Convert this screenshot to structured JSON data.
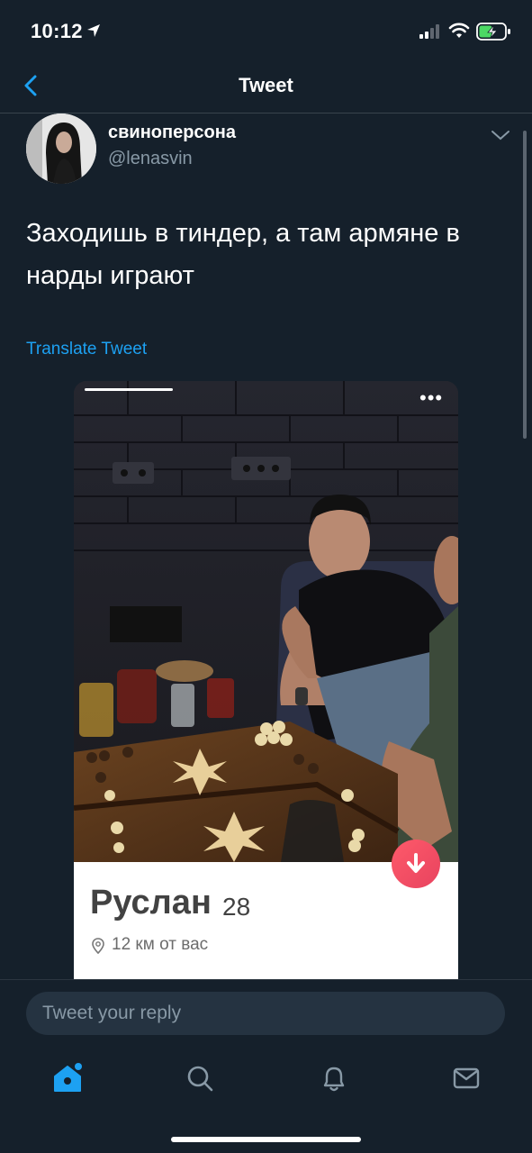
{
  "status_bar": {
    "time": "10:12"
  },
  "nav": {
    "title": "Tweet"
  },
  "tweet": {
    "display_name": "свиноперсона",
    "handle": "@lenasvin",
    "text": "Заходишь в тиндер, а там армяне в нарды играют",
    "translate_label": "Translate Tweet"
  },
  "media": {
    "profile_name": "Руслан",
    "profile_age": "28",
    "distance": "12 км от вас",
    "more_label": "•••"
  },
  "reply": {
    "placeholder": "Tweet your reply"
  },
  "tabs": [
    "home-icon",
    "search-icon",
    "notifications-icon",
    "messages-icon"
  ],
  "colors": {
    "accent": "#1da1f2",
    "background": "#15202b",
    "tinder": "#fe5a6a"
  }
}
